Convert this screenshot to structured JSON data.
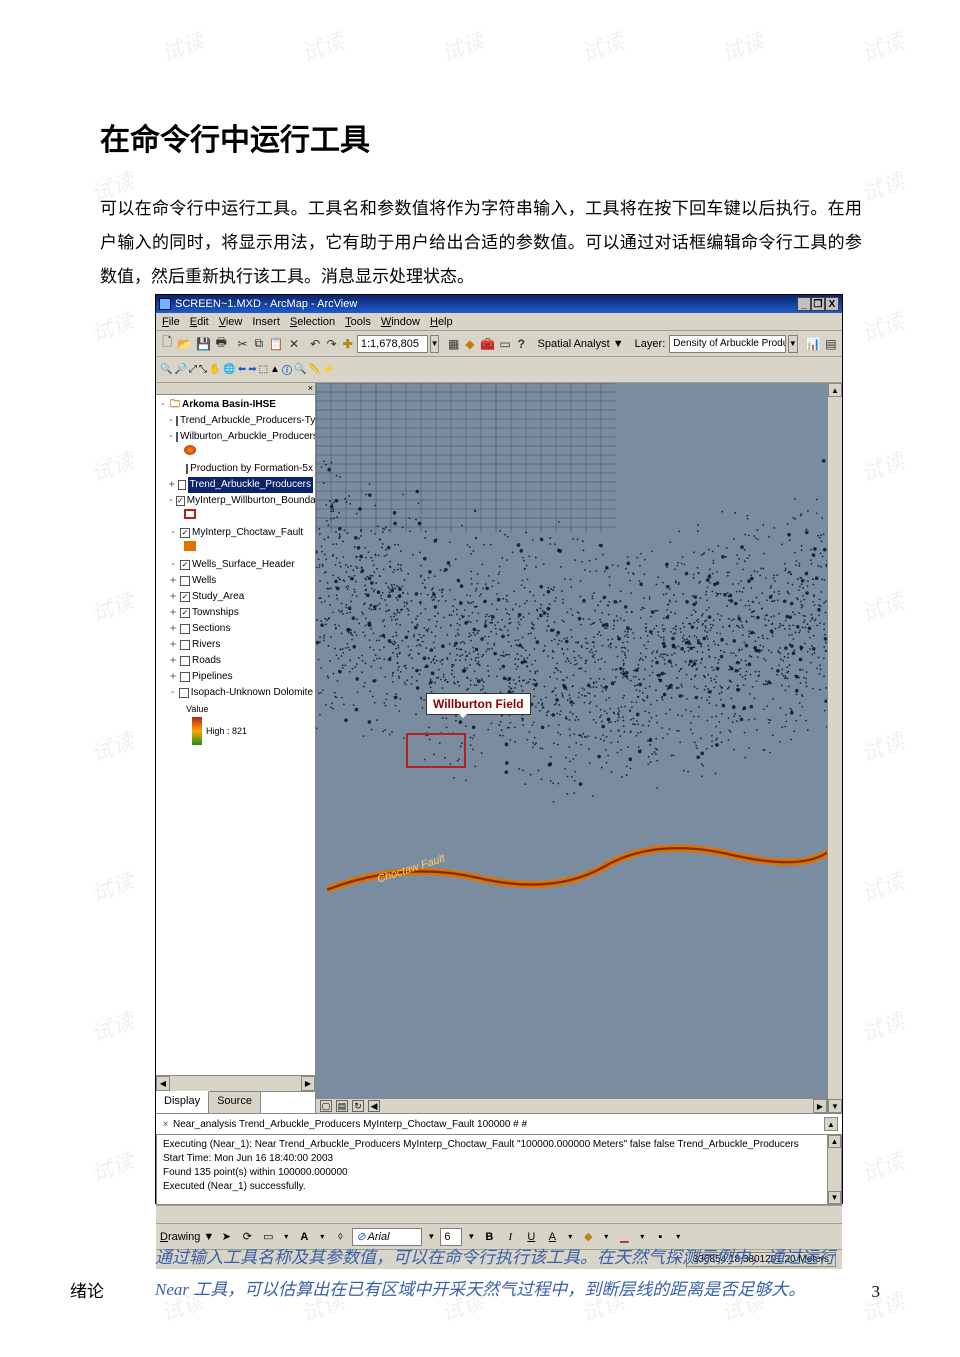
{
  "watermark_text": "试读",
  "heading": "在命令行中运行工具",
  "paragraph": "可以在命令行中运行工具。工具名和参数值将作为字符串输入，工具将在按下回车键以后执行。在用户输入的同时，将显示用法，它有助于用户给出合适的参数值。可以通过对话框编辑命令行工具的参数值，然后重新执行该工具。消息显示处理状态。",
  "app": {
    "title": "SCREEN~1.MXD - ArcMap - ArcView",
    "window_buttons": {
      "min": "_",
      "max": "❐",
      "close": "X"
    },
    "menu": [
      "File",
      "Edit",
      "View",
      "Insert",
      "Selection",
      "Tools",
      "Window",
      "Help"
    ],
    "scale": "1:1,678,805",
    "spatial_analyst": "Spatial Analyst ▼",
    "layer_label": "Layer:",
    "layer_value": "Density of Arbuckle Producers",
    "toc": {
      "root": "Arkoma Basin-IHSE",
      "items": [
        {
          "exp": "-",
          "cb": "",
          "label": "Trend_Arbuckle_Producers-Typ"
        },
        {
          "exp": "-",
          "cb": "",
          "label": "Wilburton_Arbuckle_Producers"
        },
        {
          "exp": "",
          "cb": "",
          "label": "Production by Formation-5x",
          "indent": true
        },
        {
          "exp": "+",
          "cb": "",
          "label": "Trend_Arbuckle_Producers",
          "selected": true
        },
        {
          "exp": "-",
          "cb": "✓",
          "label": "MyInterp_Willburton_Boundary"
        },
        {
          "exp": "-",
          "cb": "✓",
          "label": "MyInterp_Choctaw_Fault"
        },
        {
          "exp": "-",
          "cb": "✓",
          "label": "Wells_Surface_Header"
        },
        {
          "exp": "+",
          "cb": "",
          "label": "Wells"
        },
        {
          "exp": "+",
          "cb": "✓",
          "label": "Study_Area"
        },
        {
          "exp": "+",
          "cb": "✓",
          "label": "Townships"
        },
        {
          "exp": "+",
          "cb": "",
          "label": "Sections"
        },
        {
          "exp": "+",
          "cb": "",
          "label": "Rivers"
        },
        {
          "exp": "+",
          "cb": "",
          "label": "Roads"
        },
        {
          "exp": "+",
          "cb": "",
          "label": "Pipelines"
        },
        {
          "exp": "-",
          "cb": "",
          "label": "Isopach-Unknown Dolomite"
        }
      ],
      "value_label": "Value",
      "value_high": "High : 821",
      "tabs": [
        "Display",
        "Source"
      ]
    },
    "map": {
      "callout": "Willburton Field"
    },
    "cmd_input": "Near_analysis Trend_Arbuckle_Producers MyInterp_Choctaw_Fault 100000 # #",
    "messages": [
      "Executing (Near_1): Near Trend_Arbuckle_Producers MyInterp_Choctaw_Fault \"100000.000000 Meters\" false false Trend_Arbuckle_Producers",
      "Start Time: Mon Jun 16 18:40:00 2003",
      "Found 135 point(s) within 100000.000000",
      "Executed (Near_1) successfully."
    ],
    "drawbar": {
      "label": "Drawing ▼",
      "font": "Arial",
      "size": "6"
    },
    "status_coord": "336854.18 3801291.20 Meters"
  },
  "caption": "通过输入工具名称及其参数值，可以在命令行执行该工具。在天然气探测示例中，通过运行 Near 工具，可以估算出在已有区域中开采天然气过程中，到断层线的距离是否足够大。",
  "footer_left": "绪论",
  "footer_right": "3"
}
